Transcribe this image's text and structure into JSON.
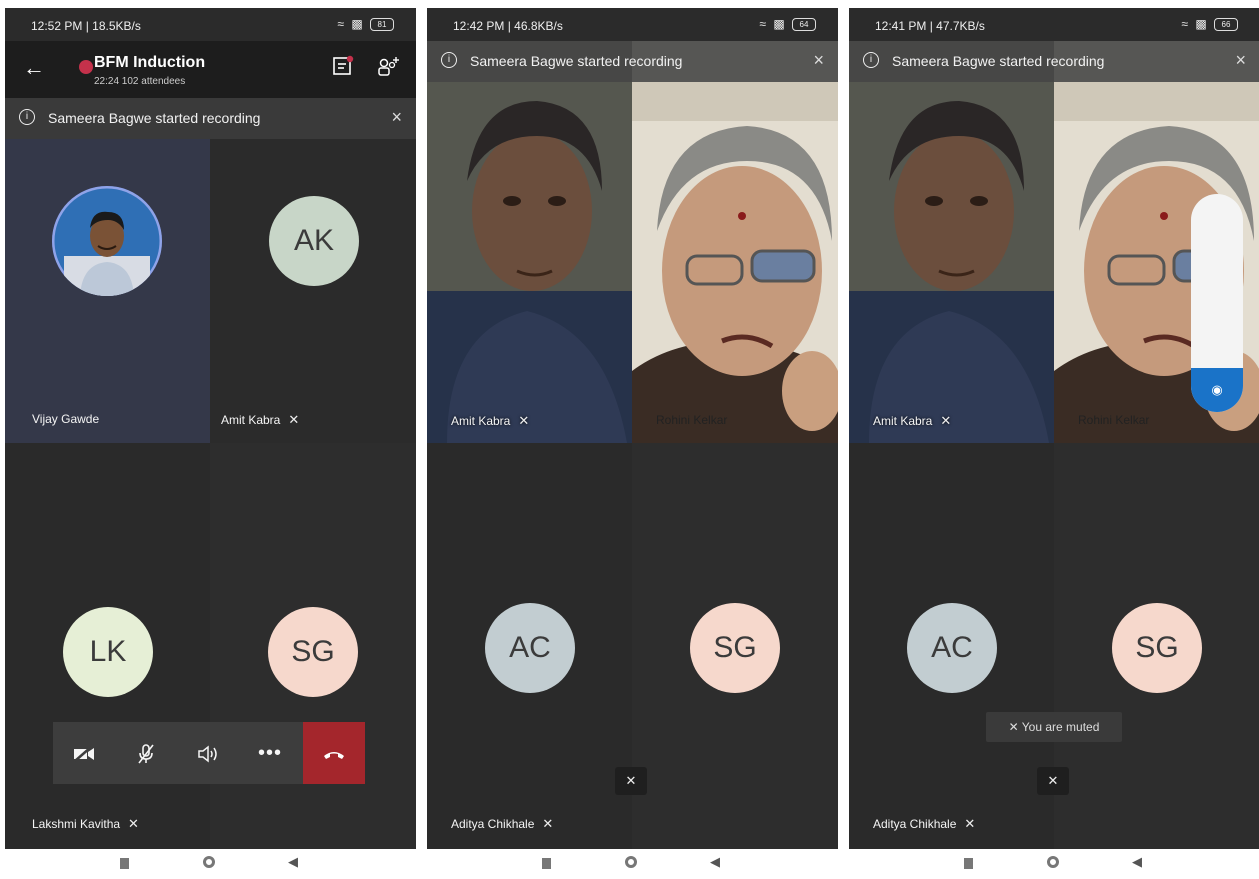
{
  "phones": [
    {
      "status": {
        "time": "12:52 PM | 18.5KB/s",
        "battery": "81"
      },
      "header": {
        "title": "BFM Induction",
        "subtitle": "22:24  102 attendees"
      },
      "banner": {
        "text": "Sameera Bagwe started recording"
      },
      "participants": [
        {
          "name": "Vijay Gawde",
          "photo": true
        },
        {
          "name": "Amit Kabra",
          "initials": "AK",
          "muted": true
        },
        {
          "name": "Lakshmi Kavitha",
          "initials": "LK",
          "muted": true
        },
        {
          "initials": "SG"
        }
      ]
    },
    {
      "status": {
        "time": "12:42 PM | 46.8KB/s",
        "battery": "64"
      },
      "banner": {
        "text": "Sameera Bagwe started recording"
      },
      "participants": [
        {
          "name": "Amit Kabra",
          "muted": true,
          "video": true
        },
        {
          "name": "Rohini Kelkar",
          "video": true
        },
        {
          "name": "Aditya Chikhale",
          "initials": "AC",
          "muted": true
        },
        {
          "initials": "SG"
        }
      ]
    },
    {
      "status": {
        "time": "12:41 PM | 47.7KB/s",
        "battery": "66"
      },
      "banner": {
        "text": "Sameera Bagwe started recording"
      },
      "participants": [
        {
          "name": "Amit Kabra",
          "muted": true,
          "video": true
        },
        {
          "name": "Rohini Kelkar",
          "video": true
        },
        {
          "name": "Aditya Chikhale",
          "initials": "AC",
          "muted": true
        },
        {
          "initials": "SG"
        }
      ],
      "toast": "You are muted"
    }
  ],
  "icons": {
    "back": "arrow-left-icon",
    "chat": "chat-icon",
    "add_people": "add-people-icon",
    "info": "info-icon",
    "close": "close-icon",
    "mic_off": "mic-off-icon",
    "camera_off": "camera-off-icon",
    "speaker": "speaker-icon",
    "more": "more-icon",
    "hangup": "hangup-icon"
  },
  "colors": {
    "recording": "#c4314b",
    "hangup": "#a4262c",
    "avatar_AK": "#c8d6c8",
    "avatar_LK": "#e6efd6",
    "avatar_SG": "#f6d8cc",
    "avatar_AC": "#c2cdd1",
    "volume_fill": "#1a73c8"
  }
}
